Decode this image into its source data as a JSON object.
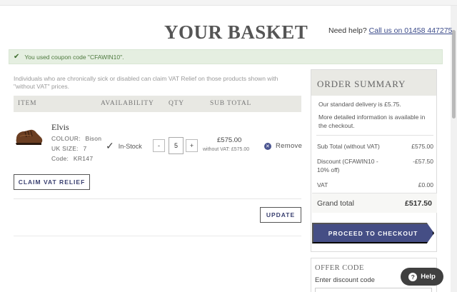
{
  "header": {
    "title": "YOUR BASKET",
    "need_help": "Need help?",
    "phone_link": "Call us on 01458 447275"
  },
  "coupon_banner": {
    "icon": "check-icon",
    "text": "You used coupon code \"CFAWIN10\"."
  },
  "vat_note": "Individuals who are chronically sick or disabled can claim VAT Relief on those products shown with \"without VAT\" prices.",
  "table_headers": {
    "item": "ITEM",
    "availability": "AVAILABILITY",
    "qty": "QTY",
    "subtotal": "SUB TOTAL"
  },
  "product": {
    "name": "Elvis",
    "colour_label": "COLOUR:",
    "colour": "Bison",
    "size_label": "UK SIZE:",
    "size": "7",
    "code_label": "Code:",
    "code": "KR147",
    "availability": "In-Stock",
    "quantity": "5",
    "minus": "-",
    "plus": "+",
    "price": "£575.00",
    "price_without_vat": "without VAT: £575.00",
    "remove_label": "Remove"
  },
  "buttons": {
    "claim_vat": "CLAIM VAT RELIEF",
    "update": "UPDATE",
    "checkout": "PROCEED TO CHECKOUT",
    "help": "Help"
  },
  "summary": {
    "title": "ORDER SUMMARY",
    "delivery_note": "Our standard delivery is £5.75.",
    "more_info": "More detailed information is available in the checkout.",
    "rows": [
      {
        "label": "Sub Total (without VAT)",
        "value": "£575.00"
      },
      {
        "label": "Discount (CFAWIN10 - 10% off)",
        "value": "-£57.50"
      },
      {
        "label": "VAT",
        "value": "£0.00"
      }
    ],
    "grand_total_label": "Grand total",
    "grand_total_value": "£517.50"
  },
  "offer": {
    "title": "OFFER CODE",
    "label": "Enter discount code"
  },
  "colors": {
    "accent": "#454e85",
    "banner_bg": "#e5efe1",
    "header_bg": "#e8e8e3"
  }
}
